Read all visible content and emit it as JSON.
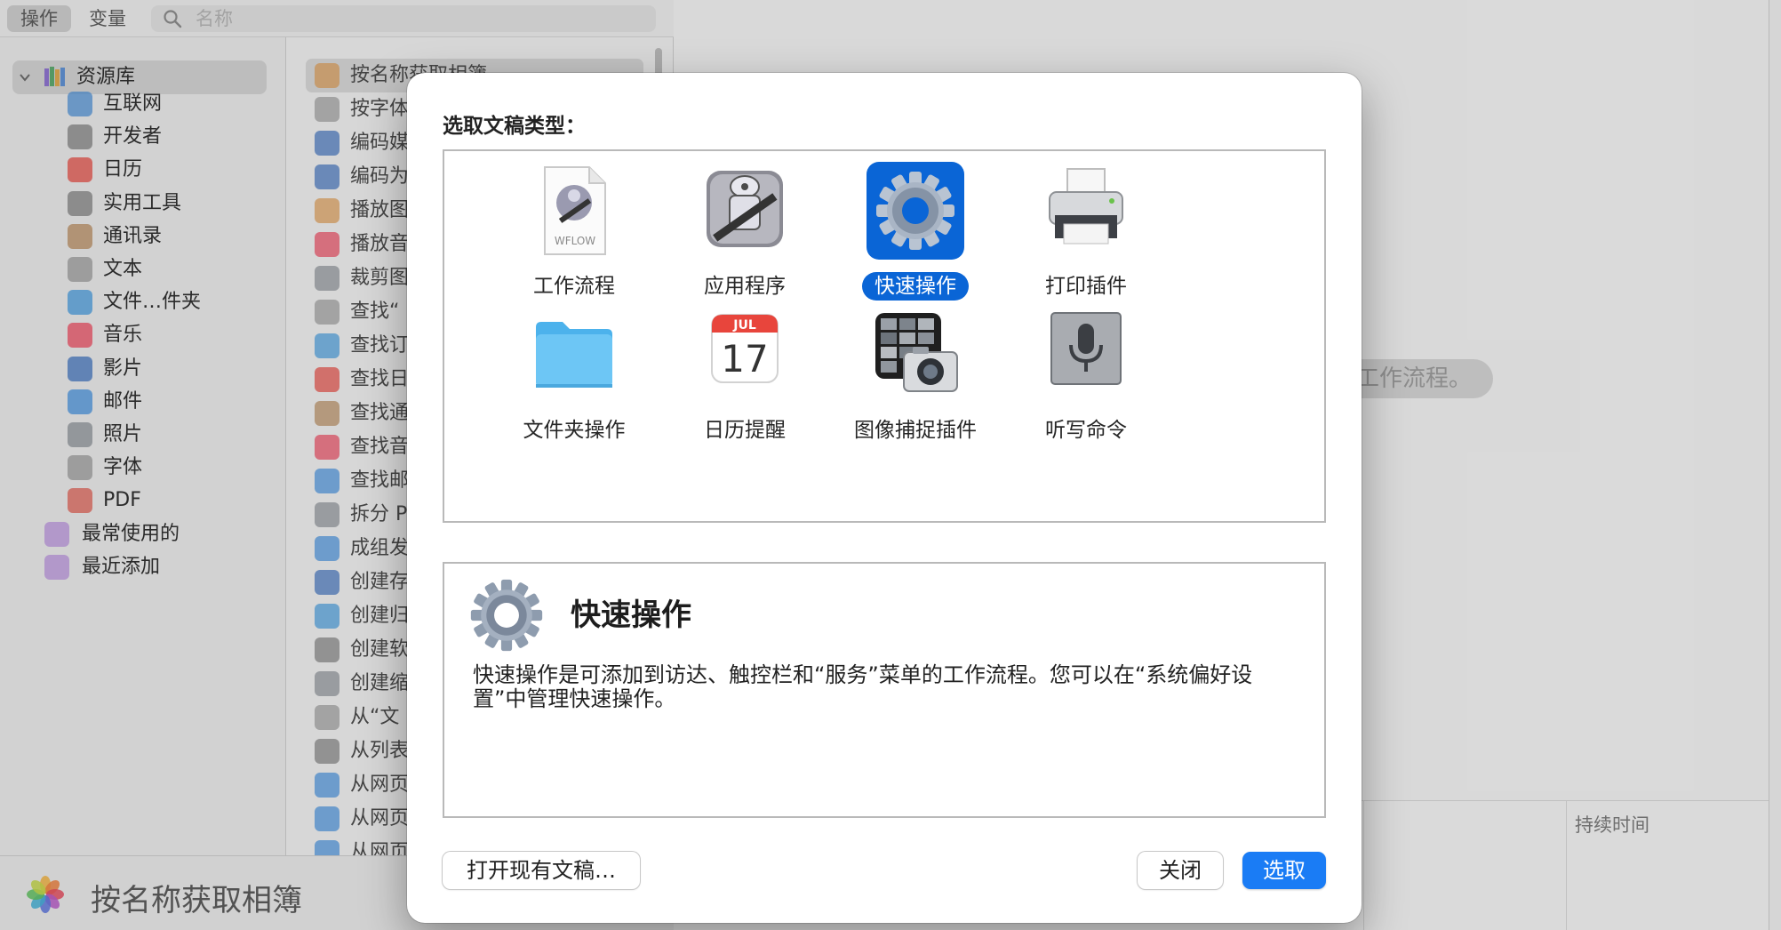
{
  "toolbar": {
    "tab_actions": "操作",
    "tab_variables": "变量",
    "search_placeholder": "名称"
  },
  "library": {
    "root": "资源库",
    "items": [
      {
        "label": "互联网",
        "icon": "globe-icon"
      },
      {
        "label": "开发者",
        "icon": "tools-icon"
      },
      {
        "label": "日历",
        "icon": "calendar-icon"
      },
      {
        "label": "实用工具",
        "icon": "tools-icon"
      },
      {
        "label": "通讯录",
        "icon": "contacts-icon"
      },
      {
        "label": "文本",
        "icon": "text-icon"
      },
      {
        "label": "文件…件夹",
        "icon": "finder-icon"
      },
      {
        "label": "音乐",
        "icon": "music-icon"
      },
      {
        "label": "影片",
        "icon": "movie-icon"
      },
      {
        "label": "邮件",
        "icon": "mail-icon"
      },
      {
        "label": "照片",
        "icon": "photo-icon"
      },
      {
        "label": "字体",
        "icon": "font-icon"
      },
      {
        "label": "PDF",
        "icon": "pdf-icon"
      }
    ],
    "smart": [
      {
        "label": "最常使用的",
        "icon": "smart-folder-icon"
      },
      {
        "label": "最近添加",
        "icon": "smart-folder-icon"
      }
    ]
  },
  "actions": {
    "items": [
      "按名称获取相簿",
      "按字体",
      "编码媒",
      "编码为",
      "播放图",
      "播放音",
      "裁剪图",
      "查找“",
      "查找订",
      "查找日",
      "查找通",
      "查找音",
      "查找邮",
      "拆分 P",
      "成组发",
      "创建存",
      "创建归",
      "创建软",
      "创建缩",
      "从“文",
      "从列表",
      "从网页",
      "从网页",
      "从网页"
    ]
  },
  "bottom_info": {
    "title": "按名称获取相簿"
  },
  "workflow": {
    "hint": "工作流程。"
  },
  "log": {
    "duration_header": "持续时间"
  },
  "dialog": {
    "title": "选取文稿类型：",
    "types": [
      {
        "label": "工作流程",
        "icon": "workflow-document-icon",
        "badge": "WFLOW"
      },
      {
        "label": "应用程序",
        "icon": "automator-app-icon"
      },
      {
        "label": "快速操作",
        "icon": "gear-icon",
        "selected": true
      },
      {
        "label": "打印插件",
        "icon": "printer-icon"
      },
      {
        "label": "文件夹操作",
        "icon": "folder-icon"
      },
      {
        "label": "日历提醒",
        "icon": "calendar-alarm-icon",
        "month": "JUL",
        "day": "17"
      },
      {
        "label": "图像捕捉插件",
        "icon": "image-capture-icon"
      },
      {
        "label": "听写命令",
        "icon": "microphone-icon"
      }
    ],
    "description": {
      "title": "快速操作",
      "body": "快速操作是可添加到访达、触控栏和“服务”菜单的工作流程。您可以在“系统偏好设置”中管理快速操作。"
    },
    "buttons": {
      "open": "打开现有文稿…",
      "close": "关闭",
      "choose": "选取"
    }
  },
  "colors": {
    "accent": "#1a7cf5",
    "selected_tile": "#0a65d6"
  }
}
